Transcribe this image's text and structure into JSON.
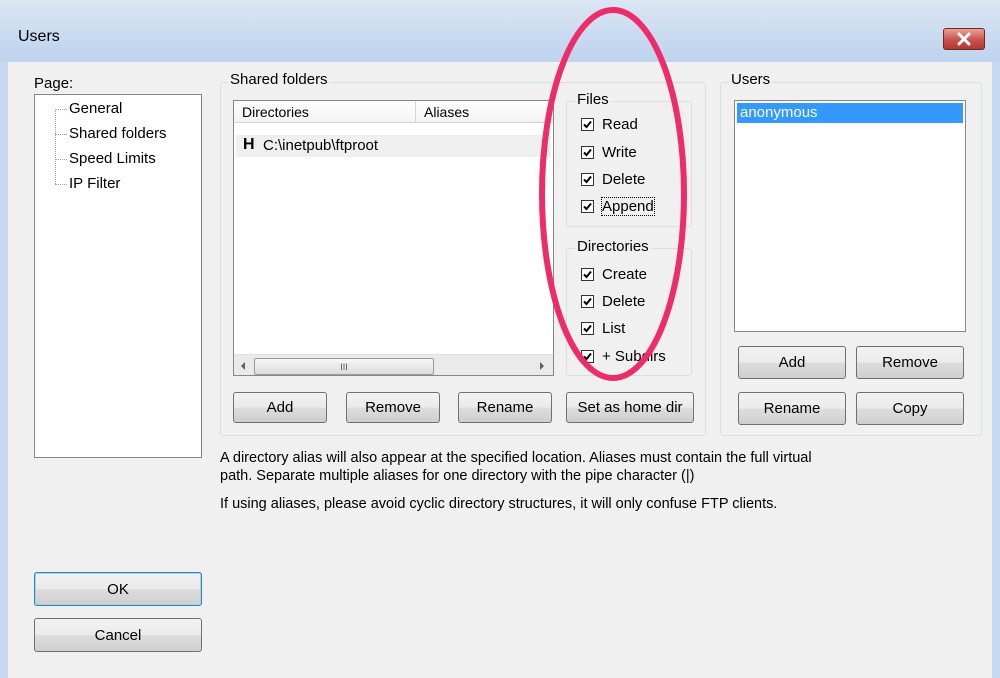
{
  "window": {
    "title": "Users",
    "close_icon": "close-icon"
  },
  "page_label": "Page:",
  "nav": {
    "items": [
      {
        "label": "General"
      },
      {
        "label": "Shared folders"
      },
      {
        "label": "Speed Limits"
      },
      {
        "label": "IP Filter"
      }
    ]
  },
  "shared_folders": {
    "legend": "Shared folders",
    "columns": [
      "Directories",
      "Aliases"
    ],
    "rows": [
      {
        "flag": "H",
        "directory": "C:\\inetpub\\ftproot",
        "alias": ""
      }
    ],
    "scroll_grip": "III",
    "buttons": {
      "add": "Add",
      "remove": "Remove",
      "rename": "Rename",
      "set_home": "Set as home dir"
    }
  },
  "files": {
    "legend": "Files",
    "options": [
      {
        "label": "Read",
        "checked": true
      },
      {
        "label": "Write",
        "checked": true
      },
      {
        "label": "Delete",
        "checked": true
      },
      {
        "label": "Append",
        "checked": true
      }
    ]
  },
  "directories": {
    "legend": "Directories",
    "options": [
      {
        "label": "Create",
        "checked": true
      },
      {
        "label": "Delete",
        "checked": true
      },
      {
        "label": "List",
        "checked": true
      },
      {
        "label": "+ Subdirs",
        "checked": true
      }
    ]
  },
  "users": {
    "legend": "Users",
    "items": [
      "anonymous"
    ],
    "buttons": {
      "add": "Add",
      "remove": "Remove",
      "rename": "Rename",
      "copy": "Copy"
    }
  },
  "notes": {
    "line1": "A directory alias will also appear at the specified location. Aliases must contain the full virtual",
    "line2": "path. Separate multiple aliases for one directory with the pipe character (|)",
    "line3": "If using aliases, please avoid cyclic directory structures, it will only confuse FTP clients."
  },
  "dialog_buttons": {
    "ok": "OK",
    "cancel": "Cancel"
  },
  "colors": {
    "selection": "#3399ff",
    "annotation": "#ec2d6a"
  }
}
